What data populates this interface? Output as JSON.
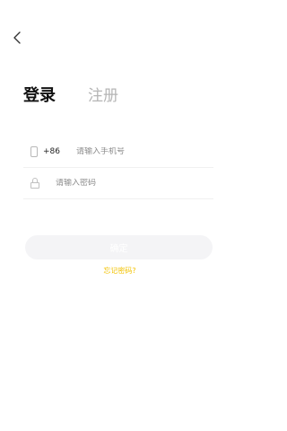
{
  "header": {
    "back_icon": "chevron-left-icon"
  },
  "tabs": {
    "login_label": "登录",
    "register_label": "注册"
  },
  "phone_field": {
    "icon": "phone-icon",
    "country_code": "+86",
    "placeholder": "请输入手机号",
    "value": ""
  },
  "password_field": {
    "icon": "lock-icon",
    "placeholder": "请输入密码",
    "value": ""
  },
  "actions": {
    "confirm_label": "确定",
    "forgot_password_label": "忘记密码?"
  },
  "colors": {
    "accent": "#f2c200",
    "button_bg": "#f4f4f6",
    "inactive_tab": "#b5b5b5"
  }
}
